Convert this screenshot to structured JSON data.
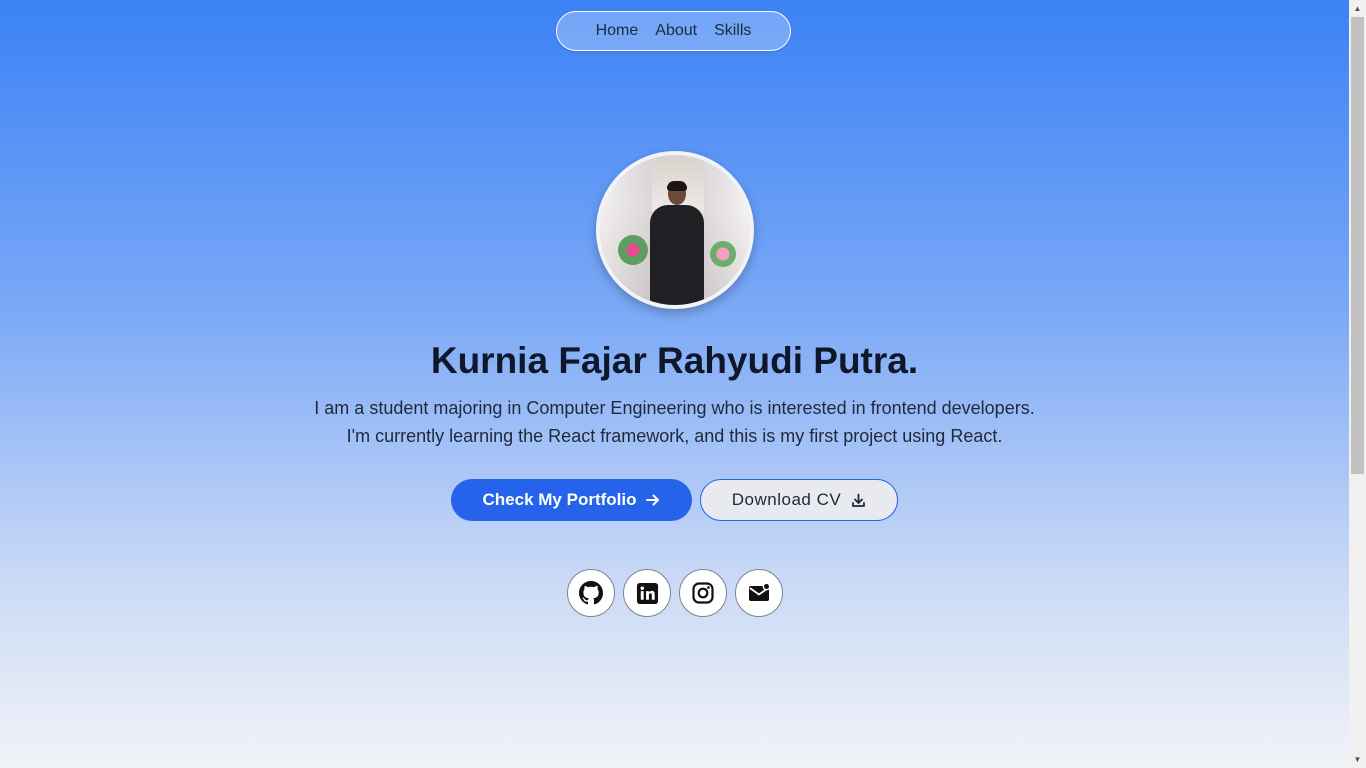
{
  "nav": {
    "items": [
      {
        "label": "Home"
      },
      {
        "label": "About"
      },
      {
        "label": "Skills"
      }
    ]
  },
  "hero": {
    "name": "Kurnia Fajar Rahyudi Putra.",
    "bio_line1": "I am a student majoring in Computer Engineering who is interested in frontend developers.",
    "bio_line2": "I'm currently learning the React framework, and this is my first project using React."
  },
  "buttons": {
    "portfolio_label": "Check My Portfolio",
    "cv_label": "Download CV"
  },
  "socials": [
    {
      "icon": "github-icon"
    },
    {
      "icon": "linkedin-icon"
    },
    {
      "icon": "instagram-icon"
    },
    {
      "icon": "mail-icon"
    }
  ],
  "colors": {
    "accent": "#2563eb",
    "gradient_top": "#3b82f6",
    "gradient_bottom": "#f1f3f7"
  }
}
